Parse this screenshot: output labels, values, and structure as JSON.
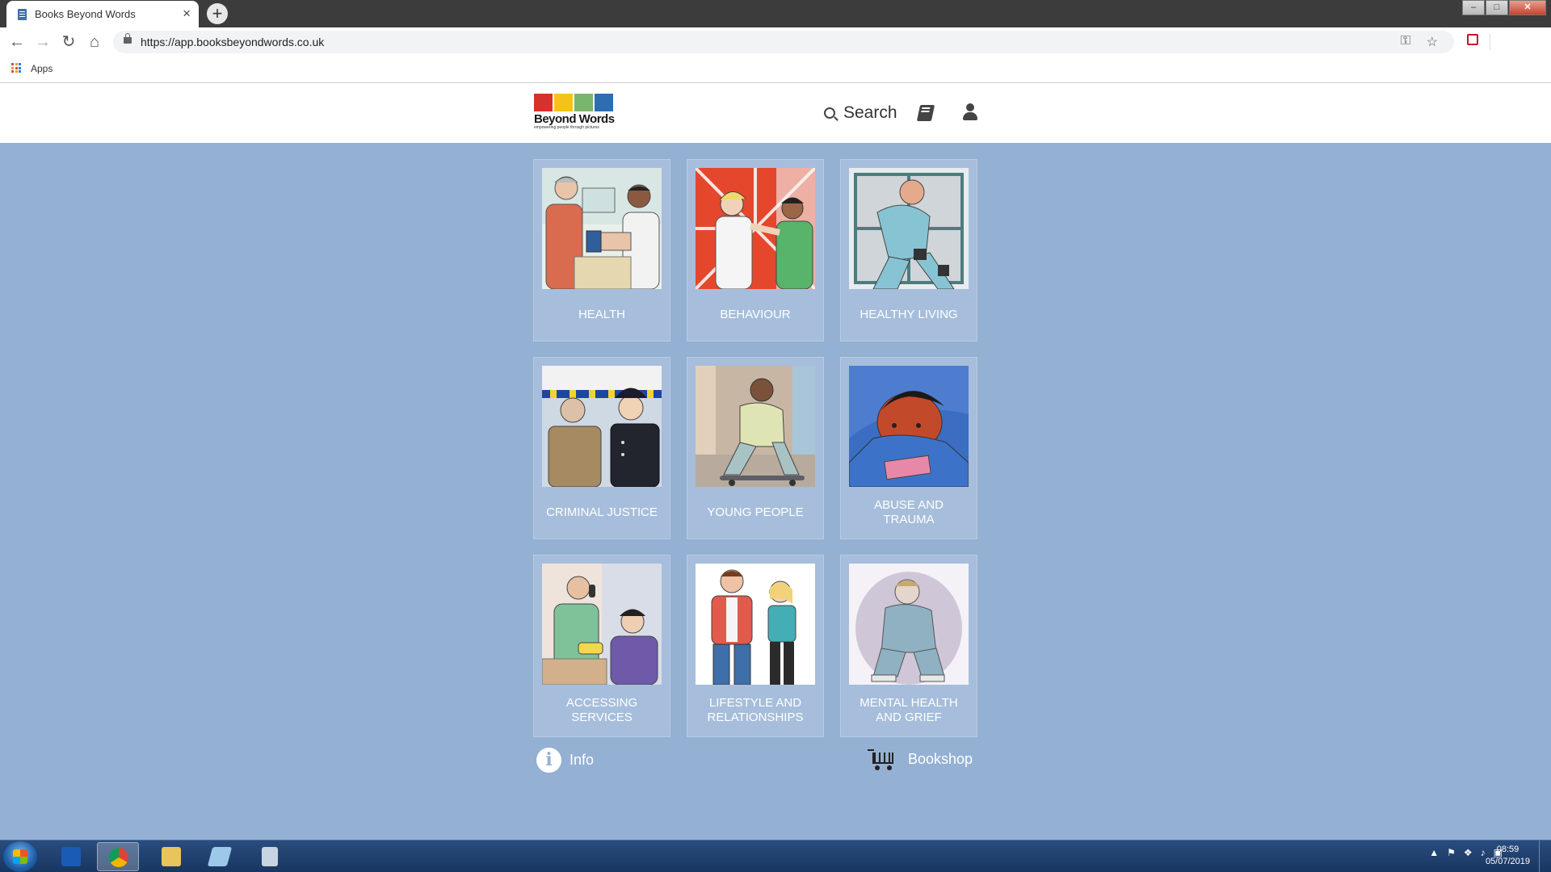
{
  "browser": {
    "tab_title": "Books Beyond Words",
    "tab_close": "×",
    "new_tab": "+",
    "url": "https://app.booksbeyondwords.co.uk",
    "bookmarks_apps": "Apps",
    "window_min": "–",
    "window_max": "□",
    "window_close": "✕"
  },
  "header": {
    "logo_text": "Beyond Words",
    "logo_tagline": "empowering people through pictures",
    "logo_colors": [
      "#d7312b",
      "#f3c417",
      "#79b56c",
      "#2f6db2"
    ],
    "search_label": "Search",
    "icons": [
      "search-icon",
      "book-icon",
      "user-icon"
    ]
  },
  "categories": [
    {
      "label": "HEALTH"
    },
    {
      "label": "BEHAVIOUR"
    },
    {
      "label": "HEALTHY LIVING"
    },
    {
      "label": "CRIMINAL JUSTICE"
    },
    {
      "label": "YOUNG PEOPLE"
    },
    {
      "label": "ABUSE AND TRAUMA"
    },
    {
      "label": "ACCESSING SERVICES"
    },
    {
      "label": "LIFESTYLE AND RELATIONSHIPS"
    },
    {
      "label": "MENTAL HEALTH AND GRIEF"
    }
  ],
  "footer_links": {
    "info_label": "Info",
    "info_glyph": "i",
    "bookshop_label": "Bookshop"
  },
  "taskbar": {
    "time": "08:59",
    "date": "05/07/2019"
  },
  "colors": {
    "page_bg": "#94b0d3",
    "tile_bg": "#a6bedb"
  }
}
